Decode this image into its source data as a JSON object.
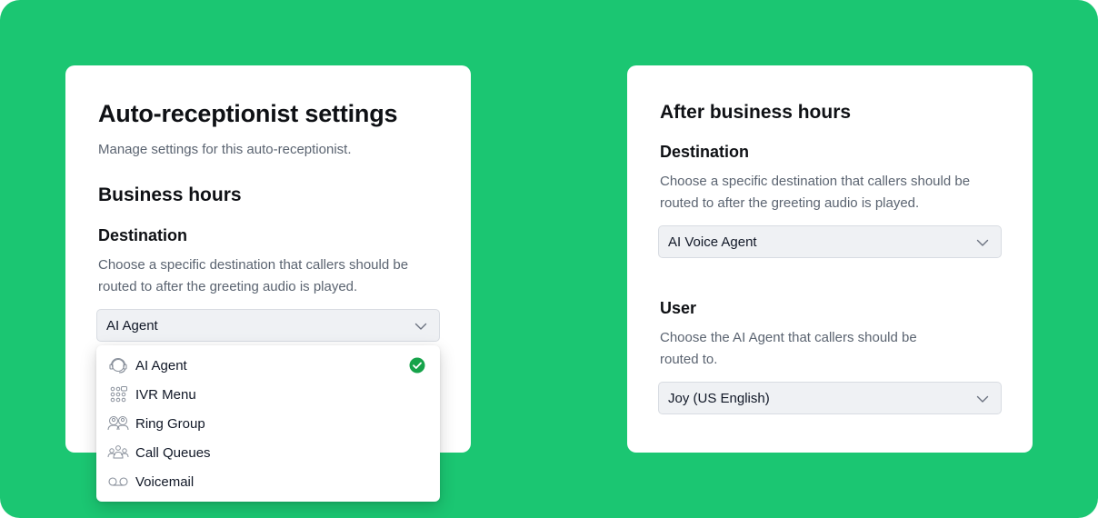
{
  "colors": {
    "background": "#1bc672",
    "check": "#16a34a"
  },
  "left_card": {
    "title": "Auto-receptionist settings",
    "subtitle": "Manage settings for this auto-receptionist.",
    "section_title": "Business hours",
    "destination": {
      "label": "Destination",
      "description_line1": "Choose a specific destination that callers should be",
      "description_line2": "routed to after the greeting audio is played.",
      "selected": "AI Agent"
    },
    "dropdown": {
      "options": [
        {
          "label": "AI Agent",
          "icon": "headset-icon",
          "selected": true
        },
        {
          "label": "IVR Menu",
          "icon": "keypad-icon",
          "selected": false
        },
        {
          "label": "Ring Group",
          "icon": "group-icon",
          "selected": false
        },
        {
          "label": "Call Queues",
          "icon": "queue-icon",
          "selected": false
        },
        {
          "label": "Voicemail",
          "icon": "voicemail-icon",
          "selected": false
        }
      ]
    }
  },
  "right_card": {
    "section_title": "After business hours",
    "destination": {
      "label": "Destination",
      "description_line1": "Choose a specific destination that callers should be",
      "description_line2": "routed to after the greeting audio is played.",
      "selected": "AI Voice Agent"
    },
    "user": {
      "label": "User",
      "description_line1": "Choose the AI Agent that callers should be",
      "description_line2": "routed to.",
      "selected": "Joy (US English)"
    }
  }
}
